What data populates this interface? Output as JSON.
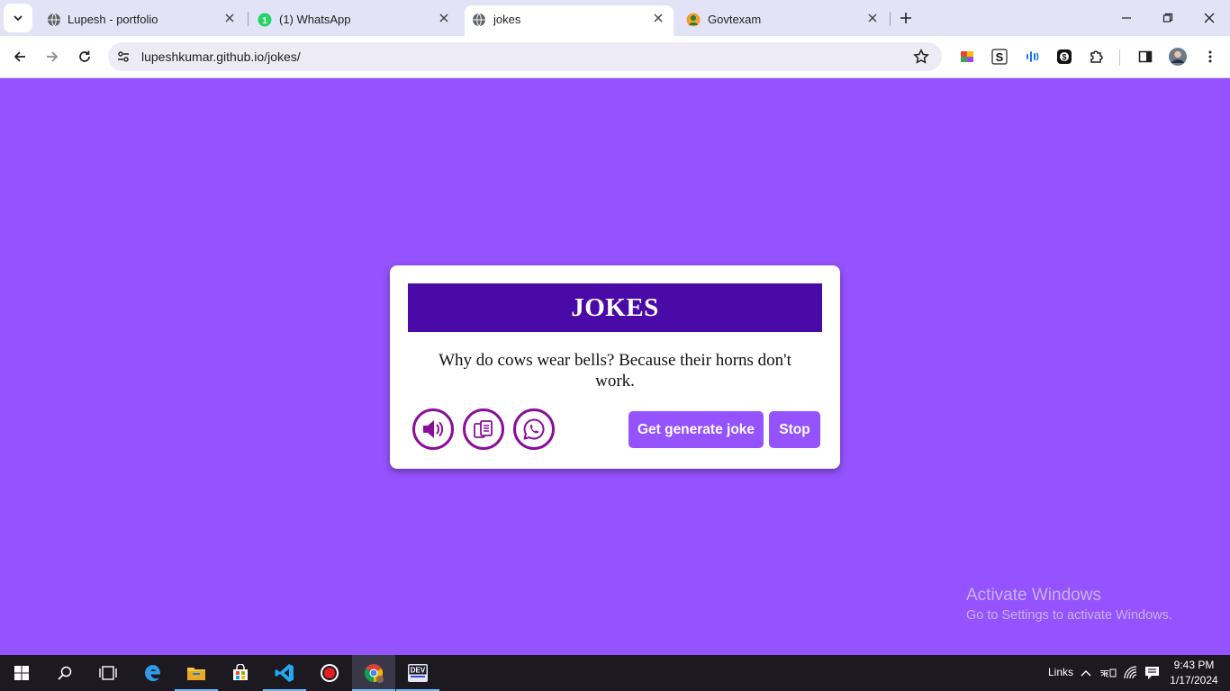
{
  "browser": {
    "tabs": [
      {
        "title": "Lupesh - portfolio",
        "active": false
      },
      {
        "title": "(1) WhatsApp",
        "active": false
      },
      {
        "title": "jokes",
        "active": true
      },
      {
        "title": "Govtexam",
        "active": false
      }
    ],
    "url": "lupeshkumar.github.io/jokes/"
  },
  "page": {
    "background": "#9552ff",
    "title": "JOKES",
    "joke": "Why do cows wear bells? Because their horns don't work.",
    "icons": [
      "speaker-icon",
      "copy-icon",
      "whatsapp-icon"
    ],
    "generate_label": "Get generate joke",
    "stop_label": "Stop"
  },
  "watermark": {
    "line1": "Activate Windows",
    "line2": "Go to Settings to activate Windows."
  },
  "taskbar": {
    "links_label": "Links",
    "time": "9:43 PM",
    "date": "1/17/2024"
  }
}
